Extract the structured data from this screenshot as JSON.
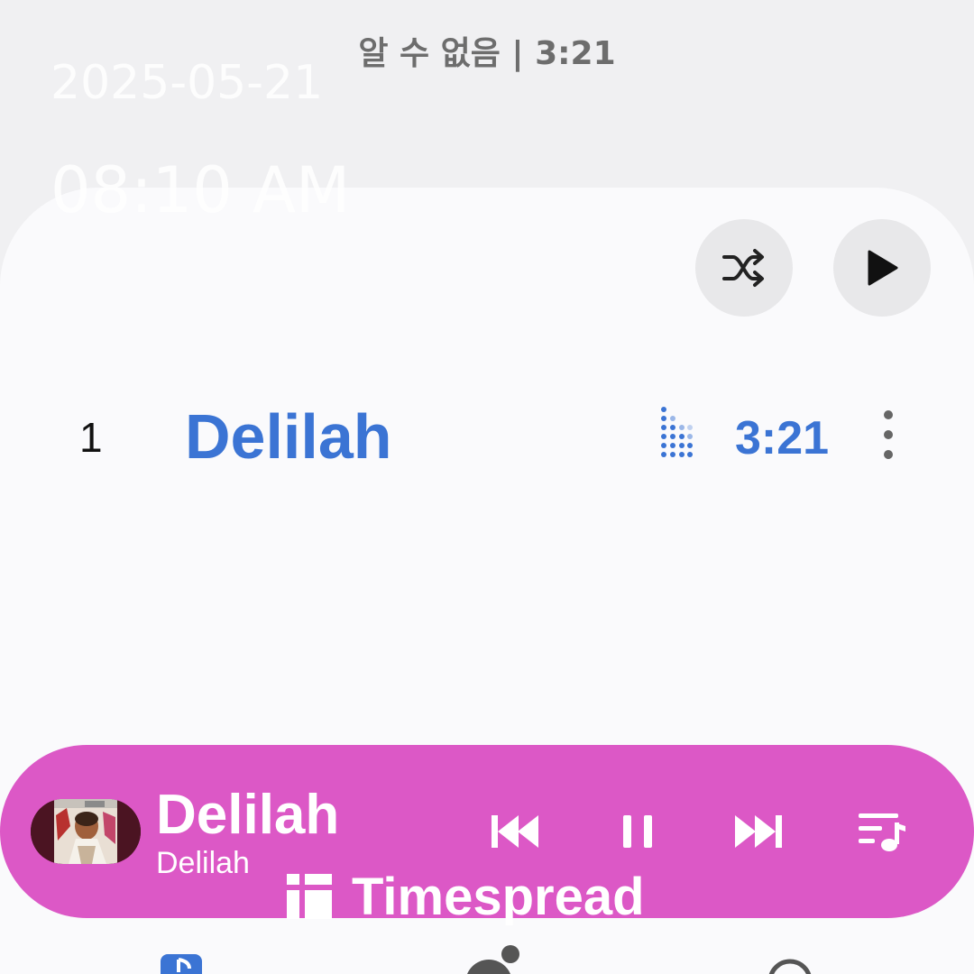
{
  "header": {
    "album_meta": "알 수 없음 | 3:21"
  },
  "photo_stamp": {
    "date": "2025-05-21",
    "time": "08:10 AM"
  },
  "actions": {
    "shuffle_icon": "shuffle-icon",
    "play_icon": "play-icon"
  },
  "tracks": [
    {
      "number": "1",
      "title": "Delilah",
      "duration": "3:21",
      "playing": true
    }
  ],
  "mini_player": {
    "title": "Delilah",
    "artist": "Delilah",
    "background": "#dc58c6",
    "icons": [
      "skip-previous-icon",
      "pause-icon",
      "skip-next-icon",
      "queue-icon"
    ]
  },
  "watermark": {
    "text": "Timespread"
  },
  "colors": {
    "accent": "#3b74d4",
    "sheet": "#fafafc",
    "backdrop": "#f0f0f2"
  }
}
